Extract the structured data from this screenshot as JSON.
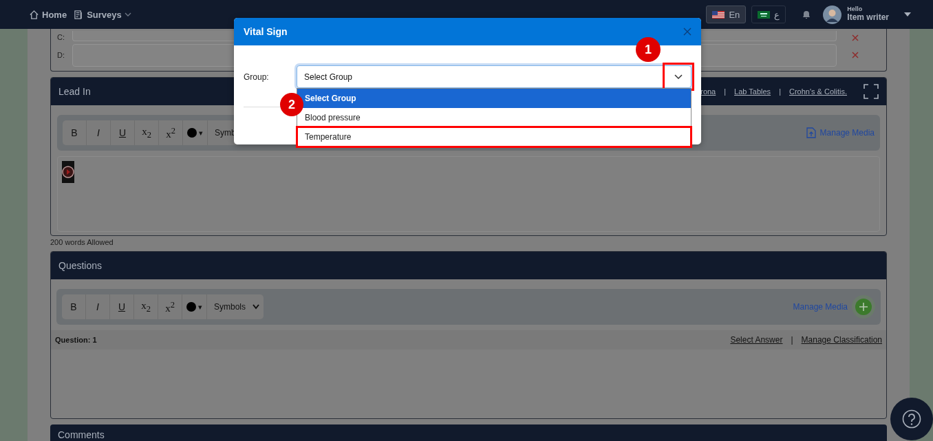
{
  "nav": {
    "links": [
      {
        "label": "Home",
        "has_menu": false
      },
      {
        "label": "Surveys",
        "has_menu": true
      }
    ],
    "languages": [
      {
        "label": "En",
        "selected": true
      },
      {
        "label": "ع",
        "selected": false
      }
    ],
    "user": {
      "greeting": "Hello",
      "name": "Item writer"
    }
  },
  "answer_rows": [
    {
      "label": "C:"
    },
    {
      "label": "D:"
    }
  ],
  "lead_in": {
    "title": "Lead In",
    "links": [
      "rona",
      "Lab Tables",
      "Crohn's & Colitis."
    ],
    "separator": "|",
    "toolbar": {
      "buttons": [
        {
          "label": "B",
          "kind": "bold"
        },
        {
          "label": "I",
          "kind": "italic"
        },
        {
          "label": "U",
          "kind": "underline"
        },
        {
          "label": "x$_{2}$",
          "kind": "script"
        },
        {
          "label": "x$^{2}$",
          "kind": "script"
        }
      ],
      "color_caret": "▾",
      "symbols": "Symb"
    },
    "manage_media": "Manage Media",
    "words_note": "200 words Allowed"
  },
  "questions": {
    "title": "Questions",
    "toolbar": {
      "buttons": [
        {
          "label": "B",
          "kind": "bold"
        },
        {
          "label": "I",
          "kind": "italic"
        },
        {
          "label": "U",
          "kind": "underline"
        },
        {
          "label": "x$_{2}$",
          "kind": "script"
        },
        {
          "label": "x$^{2}$",
          "kind": "script"
        }
      ],
      "color_caret": "▾",
      "symbols": "Symbols"
    },
    "manage_media": "Manage Media",
    "question_label": "Question: 1",
    "links": [
      "Select Answer",
      "Manage Classification"
    ],
    "separator": "|"
  },
  "comments": {
    "title": "Comments"
  },
  "modal": {
    "title": "Vital Sign",
    "field_label": "Group:",
    "select_value": "Select Group",
    "toggle_annotation": "1",
    "options": [
      {
        "label": "Select Group",
        "selected": true
      },
      {
        "label": "Blood pressure",
        "selected": false
      },
      {
        "label": "Temperature",
        "selected": false,
        "annotation": "2"
      }
    ]
  }
}
